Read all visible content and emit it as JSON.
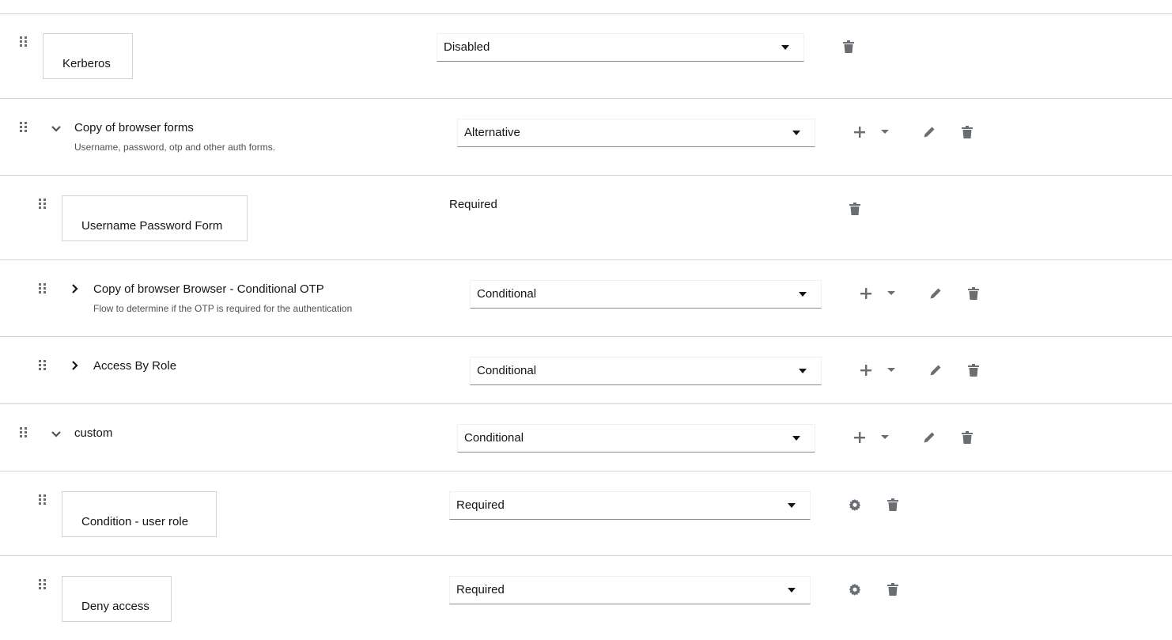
{
  "rows": [
    {
      "title": "Kerberos",
      "requirement": "Disabled"
    },
    {
      "title": "Copy of browser forms",
      "description": "Username, password, otp and other auth forms.",
      "requirement": "Alternative"
    },
    {
      "title": "Username Password Form",
      "requirement": "Required"
    },
    {
      "title": "Copy of browser Browser - Conditional OTP",
      "description": "Flow to determine if the OTP is required for the authentication",
      "requirement": "Conditional"
    },
    {
      "title": "Access By Role",
      "requirement": "Conditional"
    },
    {
      "title": "custom",
      "requirement": "Conditional"
    },
    {
      "title": "Condition - user role",
      "requirement": "Required"
    },
    {
      "title": "Deny access",
      "requirement": "Required"
    }
  ],
  "icons": {
    "drag": "drag-handle-icon",
    "expand": "chevron-down-icon",
    "collapse": "chevron-right-icon",
    "add": "plus-icon",
    "dropdown": "caret-down-icon",
    "edit": "pencil-icon",
    "delete": "trash-icon",
    "settings": "gear-icon"
  },
  "colors": {
    "icon": "#6a6e73",
    "border": "#d2d2d2",
    "text": "#151515"
  }
}
